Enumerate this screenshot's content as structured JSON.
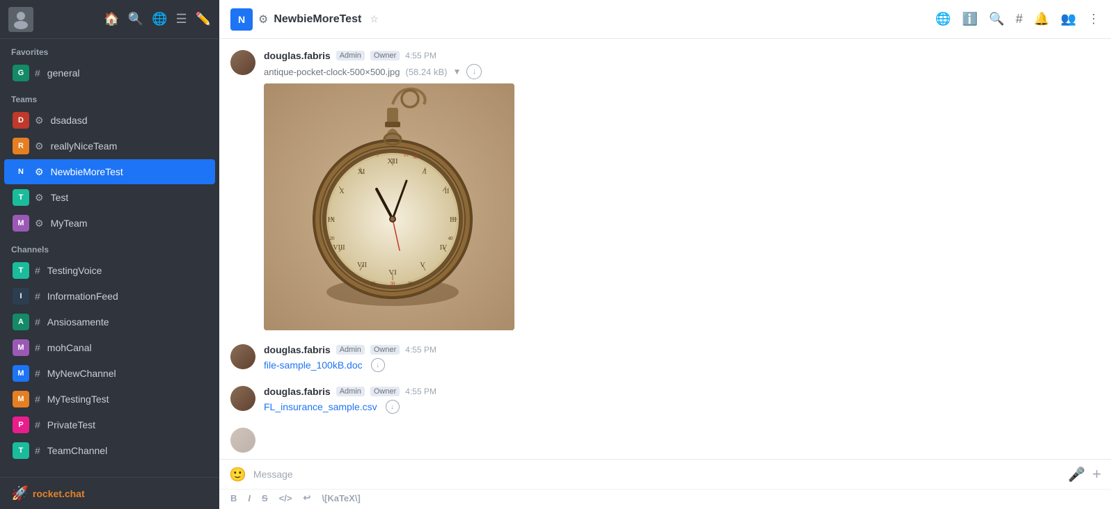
{
  "sidebar": {
    "favorites": {
      "label": "Favorites",
      "items": [
        {
          "id": "general",
          "name": "general",
          "type": "channel",
          "avatarLetter": "G",
          "avatarBg": "bg-green"
        }
      ]
    },
    "teams": {
      "label": "Teams",
      "items": [
        {
          "id": "dsadasd",
          "name": "dsadasd",
          "type": "team",
          "avatarLetter": "D",
          "avatarBg": "bg-red"
        },
        {
          "id": "reallyniceteam",
          "name": "reallyNiceTeam",
          "type": "team",
          "avatarLetter": "R",
          "avatarBg": "bg-orange"
        },
        {
          "id": "newbiemoretest",
          "name": "NewbieMoreTest",
          "type": "team",
          "avatarLetter": "N",
          "avatarBg": "bg-blue",
          "active": true
        },
        {
          "id": "test",
          "name": "Test",
          "type": "team",
          "avatarLetter": "T",
          "avatarBg": "bg-teal"
        },
        {
          "id": "myteam",
          "name": "MyTeam",
          "type": "team",
          "avatarLetter": "M",
          "avatarBg": "bg-purple"
        }
      ]
    },
    "channels": {
      "label": "Channels",
      "items": [
        {
          "id": "testingvoice",
          "name": "TestingVoice",
          "type": "channel",
          "avatarLetter": "T",
          "avatarBg": "bg-teal"
        },
        {
          "id": "informationfeed",
          "name": "InformationFeed",
          "type": "channel",
          "avatarLetter": "I",
          "avatarBg": "bg-darkblue"
        },
        {
          "id": "ansiosamente",
          "name": "Ansiosamente",
          "type": "channel",
          "avatarLetter": "A",
          "avatarBg": "bg-green"
        },
        {
          "id": "mohcanal",
          "name": "mohCanal",
          "type": "channel",
          "avatarLetter": "M",
          "avatarBg": "bg-purple"
        },
        {
          "id": "mynewchannel",
          "name": "MyNewChannel",
          "type": "channel",
          "avatarLetter": "M",
          "avatarBg": "bg-blue"
        },
        {
          "id": "mytestingtest",
          "name": "MyTestingTest",
          "type": "channel",
          "avatarLetter": "M",
          "avatarBg": "bg-orange"
        },
        {
          "id": "privatetest",
          "name": "PrivateTest",
          "type": "channel",
          "avatarLetter": "P",
          "avatarBg": "bg-pink"
        },
        {
          "id": "teamchannel",
          "name": "TeamChannel",
          "type": "channel",
          "avatarLetter": "T",
          "avatarBg": "bg-teal"
        }
      ]
    },
    "footer": {
      "logo_text": "rocket.chat"
    }
  },
  "topbar": {
    "team_name": "NewbieMoreTest",
    "icons": [
      "globe",
      "info",
      "search",
      "hashtag",
      "bell",
      "members",
      "more"
    ]
  },
  "messages": [
    {
      "id": "msg1",
      "username": "douglas.fabris",
      "badges": [
        "Admin",
        "Owner"
      ],
      "time": "4:55 PM",
      "file": {
        "name": "antique-pocket-clock-500×500.jpg",
        "size": "58.24 kB",
        "type": "image"
      }
    },
    {
      "id": "msg2",
      "username": "douglas.fabris",
      "badges": [
        "Admin",
        "Owner"
      ],
      "time": "4:55 PM",
      "file": {
        "name": "file-sample_100kB.doc",
        "type": "doc"
      }
    },
    {
      "id": "msg3",
      "username": "douglas.fabris",
      "badges": [
        "Admin",
        "Owner"
      ],
      "time": "4:55 PM",
      "file": {
        "name": "FL_insurance_sample.csv",
        "type": "csv"
      }
    }
  ],
  "input": {
    "placeholder": "Message",
    "emoji_btn": "😊",
    "formatting": [
      "B",
      "I",
      "S",
      "</>",
      "↩",
      "\\[KaTeX\\]"
    ]
  }
}
